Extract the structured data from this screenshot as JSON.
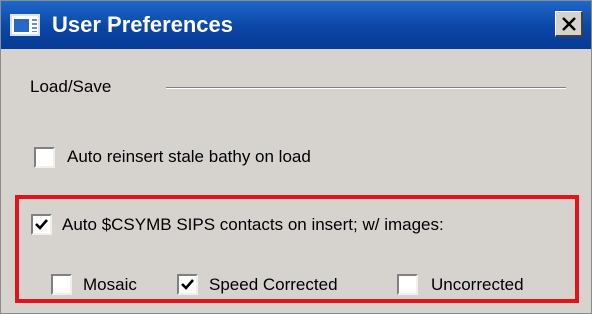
{
  "window": {
    "title": "User Preferences",
    "icon": "window-app-icon",
    "close_icon": "close-icon"
  },
  "sections": {
    "load_save": {
      "label": "Load/Save"
    }
  },
  "options": {
    "auto_reinsert": {
      "label": "Auto reinsert stale bathy on load",
      "checked": false
    },
    "auto_csymb": {
      "label": "Auto $CSYMB SIPS contacts on insert; w/ images:",
      "checked": true
    },
    "mosaic": {
      "label": "Mosaic",
      "checked": false
    },
    "speed_corrected": {
      "label": "Speed Corrected",
      "checked": true
    },
    "uncorrected": {
      "label": "Uncorrected",
      "checked": false
    }
  },
  "colors": {
    "titlebar": "#0b46a6",
    "window_bg": "#d6d3ce",
    "highlight": "#e0141a"
  }
}
